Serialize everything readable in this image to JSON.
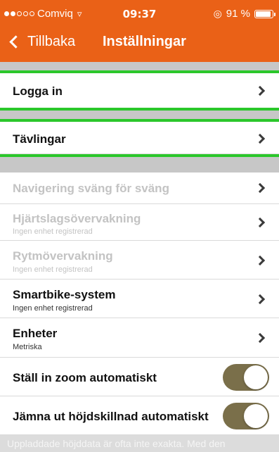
{
  "status_bar": {
    "carrier": "Comviq",
    "time": "09:37",
    "battery": "91 %",
    "battery_level": 0.91,
    "icons": [
      "signal-icon",
      "wifi-icon",
      "orientation-lock-icon",
      "battery-icon"
    ]
  },
  "nav": {
    "back_label": "Tillbaka",
    "title": "Inställningar"
  },
  "rows": {
    "login": {
      "label": "Logga in"
    },
    "competitions": {
      "label": "Tävlingar"
    },
    "turn_by_turn": {
      "label": "Navigering sväng för sväng",
      "enabled": false
    },
    "heart_rate": {
      "label": "Hjärtslagsövervakning",
      "sub": "Ingen enhet registrerad",
      "enabled": false
    },
    "cadence": {
      "label": "Rytmövervakning",
      "sub": "Ingen enhet registrerad",
      "enabled": false
    },
    "smartbike": {
      "label": "Smartbike-system",
      "sub": "Ingen enhet registrerad"
    },
    "units": {
      "label": "Enheter",
      "sub": "Metriska"
    },
    "auto_zoom": {
      "label": "Ställ in zoom automatiskt",
      "on": true
    },
    "smooth_elevation": {
      "label": "Jämna ut höjdskillnad automatiskt",
      "on": true
    }
  },
  "footer": {
    "note": "Uppladdade höjddata är ofta inte exakta. Med den"
  },
  "colors": {
    "accent": "#ea6117",
    "highlight": "#2bc72b",
    "toggle_on": "#7a6f4a"
  }
}
